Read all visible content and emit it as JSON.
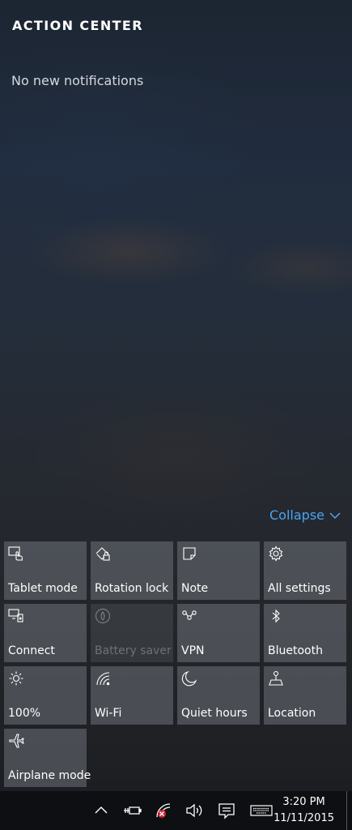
{
  "header": {
    "title": "ACTION CENTER"
  },
  "notifications": {
    "empty_text": "No new notifications"
  },
  "collapse": {
    "label": "Collapse"
  },
  "tiles": [
    {
      "label": "Tablet mode",
      "icon": "tablet-mode-icon",
      "enabled": true
    },
    {
      "label": "Rotation lock",
      "icon": "rotation-lock-icon",
      "enabled": true
    },
    {
      "label": "Note",
      "icon": "note-icon",
      "enabled": true
    },
    {
      "label": "All settings",
      "icon": "gear-icon",
      "enabled": true
    },
    {
      "label": "Connect",
      "icon": "connect-icon",
      "enabled": true
    },
    {
      "label": "Battery saver",
      "icon": "battery-saver-icon",
      "enabled": false
    },
    {
      "label": "VPN",
      "icon": "vpn-icon",
      "enabled": true
    },
    {
      "label": "Bluetooth",
      "icon": "bluetooth-icon",
      "enabled": true
    },
    {
      "label": "100%",
      "icon": "brightness-icon",
      "enabled": true
    },
    {
      "label": "Wi-Fi",
      "icon": "wifi-icon",
      "enabled": true
    },
    {
      "label": "Quiet hours",
      "icon": "moon-icon",
      "enabled": true
    },
    {
      "label": "Location",
      "icon": "location-icon",
      "enabled": true
    },
    {
      "label": "Airplane mode",
      "icon": "airplane-icon",
      "enabled": true
    }
  ],
  "taskbar": {
    "icons": [
      "chevron-up-icon",
      "power-icon",
      "network-disconnected-icon",
      "volume-icon",
      "action-center-icon",
      "keyboard-icon"
    ],
    "time": "3:20 PM",
    "date": "11/11/2015"
  },
  "colors": {
    "accent": "#4aa3f0",
    "tile": "#6e737a",
    "taskbar": "#0d0f12"
  }
}
